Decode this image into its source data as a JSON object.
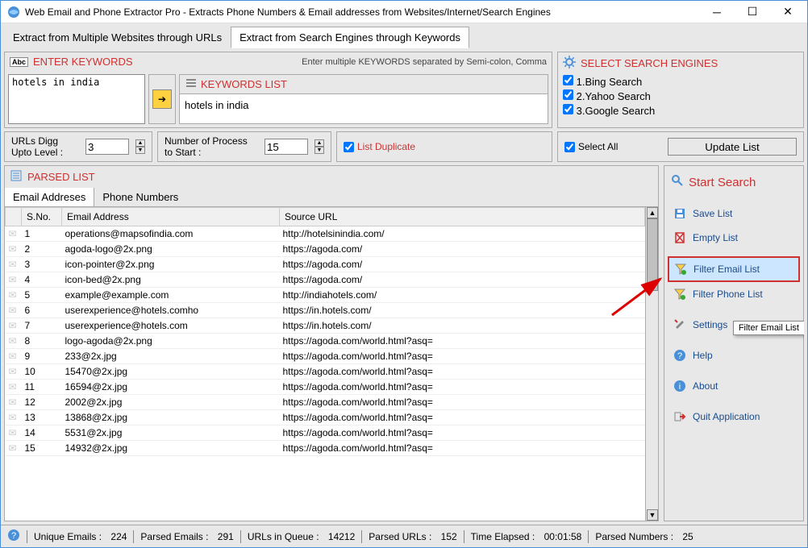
{
  "window": {
    "title": "Web Email and Phone Extractor Pro - Extracts Phone Numbers & Email addresses from Websites/Internet/Search Engines"
  },
  "main_tabs": [
    {
      "label": "Extract from Multiple Websites through URLs",
      "active": false
    },
    {
      "label": "Extract from Search Engines through Keywords",
      "active": true
    }
  ],
  "keywords_panel": {
    "header": "ENTER KEYWORDS",
    "hint": "Enter multiple KEYWORDS separated by Semi-colon, Comma",
    "input_value": "hotels in india",
    "list_header": "KEYWORDS LIST",
    "list_item": "hotels in india"
  },
  "engines_panel": {
    "header": "SELECT SEARCH ENGINES",
    "items": [
      {
        "label": "1.Bing Search",
        "checked": true
      },
      {
        "label": "2.Yahoo Search",
        "checked": true
      },
      {
        "label": "3.Google Search",
        "checked": true
      }
    ],
    "select_all_label": "Select All",
    "select_all_checked": true,
    "update_btn": "Update List"
  },
  "options": {
    "digg_label": "URLs Digg Upto Level :",
    "digg_value": "3",
    "process_label": "Number of Process to Start :",
    "process_value": "15",
    "list_duplicate_label": "List Duplicate",
    "list_duplicate_checked": true
  },
  "parsed": {
    "header": "PARSED LIST",
    "tabs": [
      {
        "label": "Email Addreses",
        "active": true
      },
      {
        "label": "Phone Numbers",
        "active": false
      }
    ],
    "columns": [
      "S.No.",
      "Email Address",
      "Source URL"
    ],
    "rows": [
      {
        "sno": "1",
        "email": "operations@mapsofindia.com",
        "url": "http://hotelsinindia.com/"
      },
      {
        "sno": "2",
        "email": "agoda-logo@2x.png",
        "url": "https://agoda.com/"
      },
      {
        "sno": "3",
        "email": "icon-pointer@2x.png",
        "url": "https://agoda.com/"
      },
      {
        "sno": "4",
        "email": "icon-bed@2x.png",
        "url": "https://agoda.com/"
      },
      {
        "sno": "5",
        "email": "example@example.com",
        "url": "http://indiahotels.com/"
      },
      {
        "sno": "6",
        "email": "userexperience@hotels.comho",
        "url": "https://in.hotels.com/"
      },
      {
        "sno": "7",
        "email": "userexperience@hotels.com",
        "url": "https://in.hotels.com/"
      },
      {
        "sno": "8",
        "email": "logo-agoda@2x.png",
        "url": "https://agoda.com/world.html?asq="
      },
      {
        "sno": "9",
        "email": "233@2x.jpg",
        "url": "https://agoda.com/world.html?asq="
      },
      {
        "sno": "10",
        "email": "15470@2x.jpg",
        "url": "https://agoda.com/world.html?asq="
      },
      {
        "sno": "11",
        "email": "16594@2x.jpg",
        "url": "https://agoda.com/world.html?asq="
      },
      {
        "sno": "12",
        "email": "2002@2x.jpg",
        "url": "https://agoda.com/world.html?asq="
      },
      {
        "sno": "13",
        "email": "13868@2x.jpg",
        "url": "https://agoda.com/world.html?asq="
      },
      {
        "sno": "14",
        "email": "5531@2x.jpg",
        "url": "https://agoda.com/world.html?asq="
      },
      {
        "sno": "15",
        "email": "14932@2x.jpg",
        "url": "https://agoda.com/world.html?asq="
      }
    ]
  },
  "side": {
    "start": "Start Search",
    "items": [
      {
        "key": "save",
        "label": "Save List",
        "icon": "save-icon"
      },
      {
        "key": "empty",
        "label": "Empty List",
        "icon": "empty-icon"
      },
      {
        "key": "filter-email",
        "label": "Filter Email List",
        "icon": "filter-icon",
        "selected": true
      },
      {
        "key": "filter-phone",
        "label": "Filter Phone List",
        "icon": "filter-icon"
      },
      {
        "key": "settings",
        "label": "Settings",
        "icon": "settings-icon"
      },
      {
        "key": "help",
        "label": "Help",
        "icon": "help-icon"
      },
      {
        "key": "about",
        "label": "About",
        "icon": "about-icon"
      },
      {
        "key": "quit",
        "label": "Quit Application",
        "icon": "quit-icon"
      }
    ],
    "tooltip": "Filter Email List"
  },
  "status": {
    "unique_emails_label": "Unique Emails :",
    "unique_emails": "224",
    "parsed_emails_label": "Parsed Emails :",
    "parsed_emails": "291",
    "urls_queue_label": "URLs in Queue :",
    "urls_queue": "14212",
    "parsed_urls_label": "Parsed URLs :",
    "parsed_urls": "152",
    "time_label": "Time Elapsed :",
    "time": "00:01:58",
    "parsed_numbers_label": "Parsed Numbers :",
    "parsed_numbers": "25"
  }
}
